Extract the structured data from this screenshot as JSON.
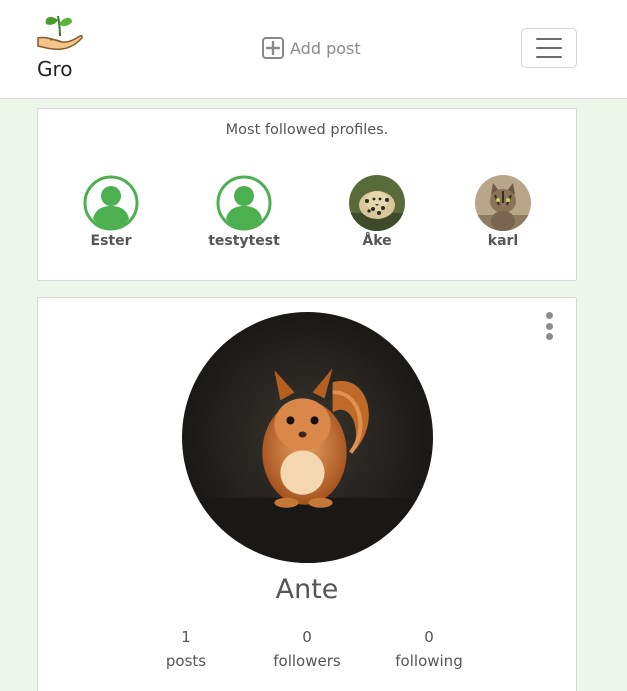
{
  "brand": {
    "name": "Gro"
  },
  "nav": {
    "add_post": "Add post"
  },
  "followed": {
    "title": "Most followed profiles.",
    "profiles": [
      {
        "name": "Ester",
        "avatar": "default-user-icon"
      },
      {
        "name": "testytest",
        "avatar": "default-user-icon"
      },
      {
        "name": "Åke",
        "avatar": "leopard-photo"
      },
      {
        "name": "karl",
        "avatar": "cat-photo"
      }
    ]
  },
  "profile": {
    "name": "Ante",
    "avatar": "squirrel-photo",
    "stats": [
      {
        "value": "1",
        "label": "posts"
      },
      {
        "value": "0",
        "label": "followers"
      },
      {
        "value": "0",
        "label": "following"
      }
    ]
  },
  "colors": {
    "page_background": "#eef6ec",
    "user_icon_green": "#4caf50",
    "text_gray": "#555555"
  }
}
